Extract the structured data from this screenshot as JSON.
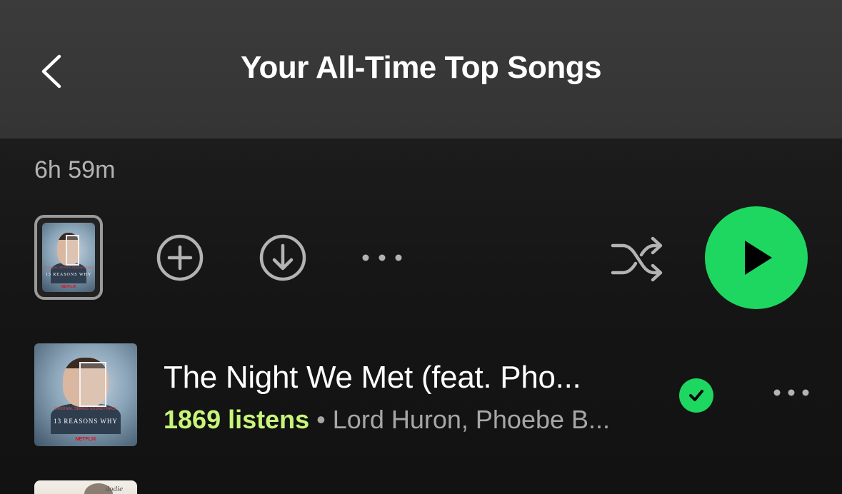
{
  "header": {
    "title": "Your All-Time Top Songs",
    "back_icon": "chevron-left-icon"
  },
  "playlist": {
    "duration": "6h 59m",
    "cover": {
      "brand": "13 REASONS WHY",
      "network": "NETFLIX",
      "subtitle": "ORIGINAL SERIES SOUNDTRACK"
    }
  },
  "actions": {
    "add_icon": "plus-circle-icon",
    "download_icon": "download-circle-icon",
    "more_icon": "more-horizontal-icon",
    "shuffle_icon": "shuffle-icon",
    "play_icon": "play-icon"
  },
  "tracks": [
    {
      "title": "The Night We Met (feat. Pho...",
      "listens": "1869 listens",
      "separator": "•",
      "artists": "Lord Huron, Phoebe B...",
      "downloaded_icon": "check-circle-icon",
      "cover": {
        "brand": "13 REASONS WHY",
        "network": "NETFLIX",
        "subtitle": "ORIGINAL SERIES SOUNDTRACK"
      }
    },
    {
      "cover_text": "dodie"
    }
  ],
  "colors": {
    "accent_green": "#1ed760",
    "listens_green": "#c7f57a",
    "header_bg": "#3b3b3b",
    "background": "#121212",
    "secondary_text": "#a7a7a7"
  }
}
